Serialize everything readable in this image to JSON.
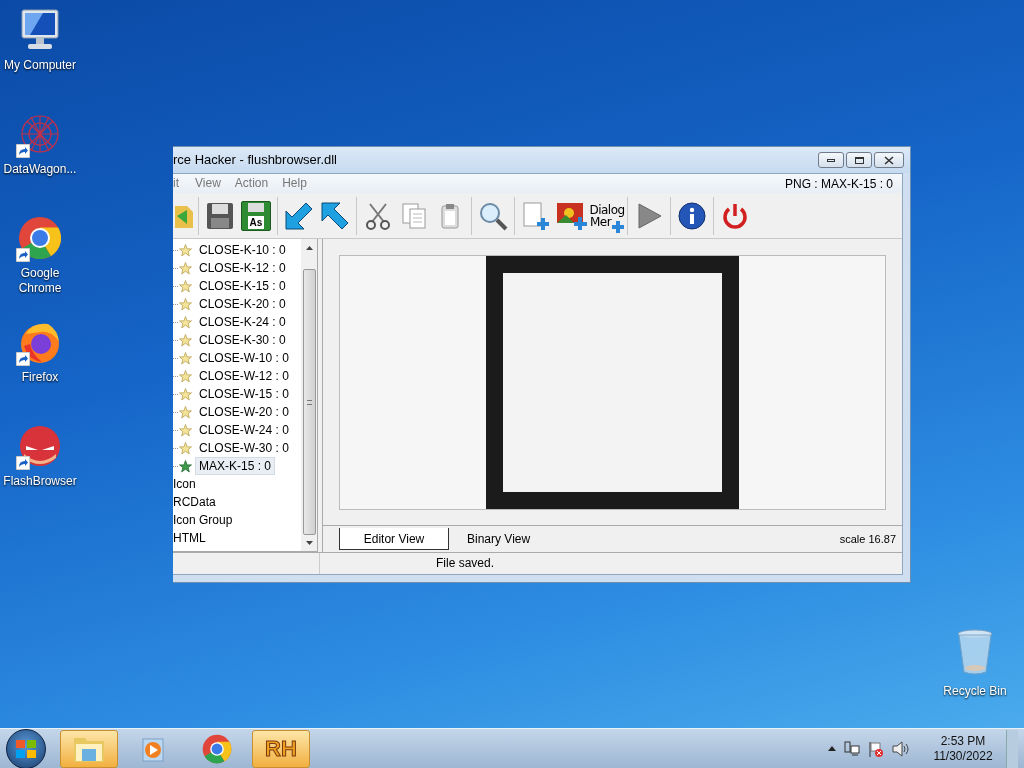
{
  "desktop_icons": [
    {
      "kind": "computer",
      "label": "My Computer",
      "shortcut": false
    },
    {
      "kind": "web",
      "label": "DataWagon...",
      "shortcut": true
    },
    {
      "kind": "chrome",
      "label": "Google Chrome",
      "shortcut": true
    },
    {
      "kind": "firefox",
      "label": "Firefox",
      "shortcut": true
    },
    {
      "kind": "mask",
      "label": "FlashBrowser",
      "shortcut": true
    }
  ],
  "recycle_bin": {
    "label": "Recycle Bin"
  },
  "window": {
    "title": "rce Hacker - flushbrowser.dll",
    "menu": [
      "it",
      "View",
      "Action",
      "Help"
    ],
    "resource_info": "PNG : MAX-K-15 : 0",
    "toolbar": {
      "save_as_label": "As",
      "dialog_menu_label": [
        "Dialog",
        "Mer"
      ]
    },
    "tree": [
      {
        "kind": "leaf",
        "label": "CLOSE-K-10 : 0",
        "selected": false
      },
      {
        "kind": "leaf",
        "label": "CLOSE-K-12 : 0",
        "selected": false
      },
      {
        "kind": "leaf",
        "label": "CLOSE-K-15 : 0",
        "selected": false
      },
      {
        "kind": "leaf",
        "label": "CLOSE-K-20 : 0",
        "selected": false
      },
      {
        "kind": "leaf",
        "label": "CLOSE-K-24 : 0",
        "selected": false
      },
      {
        "kind": "leaf",
        "label": "CLOSE-K-30 : 0",
        "selected": false
      },
      {
        "kind": "leaf",
        "label": "CLOSE-W-10 : 0",
        "selected": false
      },
      {
        "kind": "leaf",
        "label": "CLOSE-W-12 : 0",
        "selected": false
      },
      {
        "kind": "leaf",
        "label": "CLOSE-W-15 : 0",
        "selected": false
      },
      {
        "kind": "leaf",
        "label": "CLOSE-W-20 : 0",
        "selected": false
      },
      {
        "kind": "leaf",
        "label": "CLOSE-W-24 : 0",
        "selected": false
      },
      {
        "kind": "leaf",
        "label": "CLOSE-W-30 : 0",
        "selected": false
      },
      {
        "kind": "leaf",
        "label": "MAX-K-15 : 0",
        "selected": true
      },
      {
        "kind": "group",
        "label": "Icon",
        "selected": false
      },
      {
        "kind": "group",
        "label": "RCData",
        "selected": false
      },
      {
        "kind": "group",
        "label": "Icon Group",
        "selected": false
      },
      {
        "kind": "group",
        "label": "HTML",
        "selected": false
      }
    ],
    "view_tabs": [
      {
        "label": "Editor View",
        "selected": true
      },
      {
        "label": "Binary View",
        "selected": false
      }
    ],
    "scale": "scale 16.87",
    "status": "File saved."
  },
  "taskbar": {
    "apps": [
      {
        "kind": "explorer",
        "active": true
      },
      {
        "kind": "media",
        "active": false
      },
      {
        "kind": "chrome",
        "active": false
      },
      {
        "kind": "rh",
        "label": "RH",
        "active": true
      }
    ],
    "time": "2:53 PM",
    "date": "11/30/2022"
  }
}
